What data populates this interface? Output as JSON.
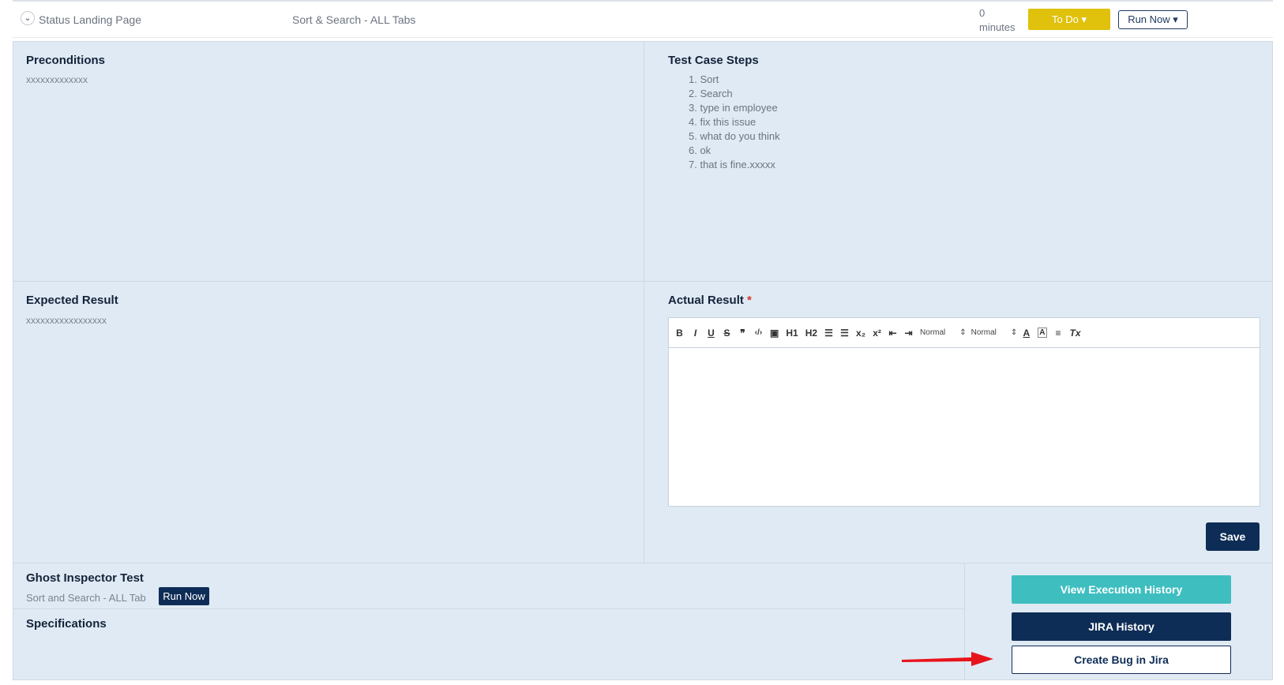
{
  "header": {
    "title": "Status Landing Page",
    "suite": "Sort & Search - ALL Tabs",
    "minutes_value": "0",
    "minutes_label": "minutes",
    "status_button": "To Do",
    "run_button": "Run Now"
  },
  "preconditions": {
    "title": "Preconditions",
    "body": "xxxxxxxxxxxxx"
  },
  "steps": {
    "title": "Test Case Steps",
    "items": [
      "1. Sort",
      "2. Search",
      "3. type in employee",
      "4. fix this issue",
      "5. what do you think",
      "6. ok",
      "7. that is fine.xxxxx"
    ]
  },
  "expected": {
    "title": "Expected Result",
    "body": "xxxxxxxxxxxxxxxxx"
  },
  "actual": {
    "title": "Actual Result",
    "required_mark": "*",
    "toolbar": {
      "bold": "B",
      "italic": "I",
      "underline": "U",
      "strike": "S",
      "quote": "❞",
      "code": "‹/›",
      "image": "▣",
      "h1": "H1",
      "h2": "H2",
      "ol": "☰",
      "ul": "☰",
      "sub": "x₂",
      "sup": "x²",
      "outdent": "⇤",
      "indent": "⇥",
      "font_size": "Normal",
      "heading": "Normal",
      "color": "A",
      "bg": "A",
      "align": "≡",
      "clear": "Tx"
    },
    "save_label": "Save"
  },
  "ghost": {
    "title": "Ghost Inspector Test",
    "name": "Sort and Search - ALL Tab",
    "run_label": "Run Now"
  },
  "specs": {
    "title": "Specifications"
  },
  "actions": {
    "exec_history": "View Execution History",
    "jira_history": "JIRA History",
    "create_bug": "Create Bug in Jira"
  },
  "colors": {
    "primary": "#0e2d56",
    "teal": "#3fbec0",
    "status": "#e0c10c",
    "panel": "#e0eaf4",
    "arrow": "#e8141b"
  }
}
